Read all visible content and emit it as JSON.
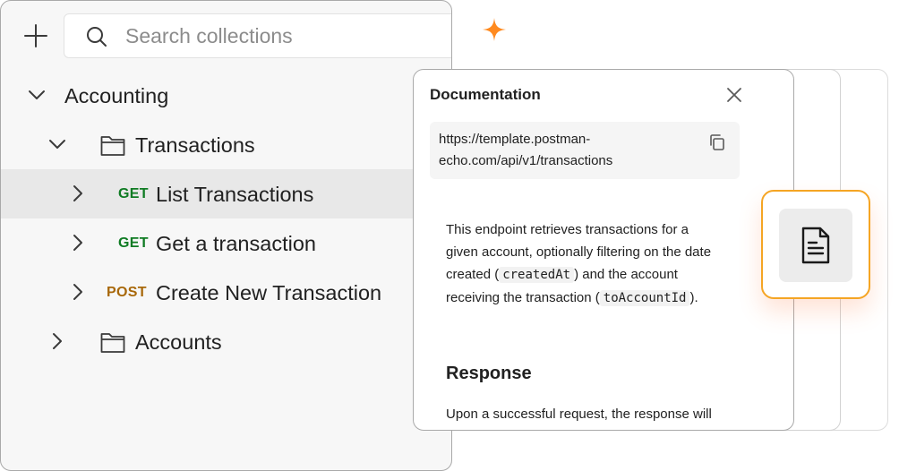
{
  "search": {
    "placeholder": "Search collections"
  },
  "tree": {
    "collection": {
      "label": "Accounting"
    },
    "folders": [
      {
        "label": "Transactions"
      },
      {
        "label": "Accounts"
      }
    ],
    "requests": [
      {
        "method": "GET",
        "label": "List Transactions",
        "selected": true
      },
      {
        "method": "GET",
        "label": "Get a transaction",
        "selected": false
      },
      {
        "method": "POST",
        "label": "Create New Transaction",
        "selected": false
      }
    ]
  },
  "documentation": {
    "title": "Documentation",
    "url": "https://template.postman-echo.com/api/v1/transactions",
    "body": {
      "part1": "This endpoint retrieves transactions for a given account, optionally filtering on the date created (",
      "code1": "createdAt",
      "part2": ") and the account receiving the transaction (",
      "code2": "toAccountId",
      "part3": ")."
    },
    "response_heading": "Response",
    "response_text": "Upon a successful request, the response will contain an array of transaction objects."
  },
  "icons": {
    "add": "plus-icon",
    "search": "search-icon",
    "expand": "chevron-down-icon",
    "collapse": "chevron-right-icon",
    "folder": "folder-icon",
    "close": "close-icon",
    "copy": "copy-icon",
    "document": "document-icon",
    "sparkle": "sparkle-icon"
  },
  "colors": {
    "get": "#0f7b23",
    "post": "#a8680a",
    "accent": "#f5a524",
    "sparkle": "#ff8a1f"
  }
}
